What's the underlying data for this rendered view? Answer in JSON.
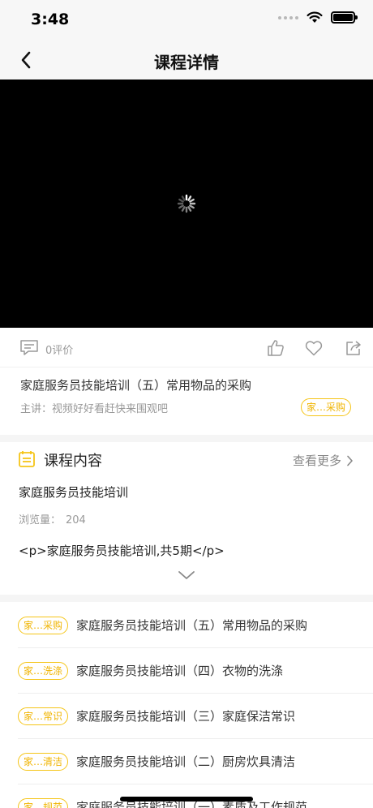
{
  "status_bar": {
    "time": "3:48"
  },
  "nav": {
    "title": "课程详情"
  },
  "video": {
    "state": "loading"
  },
  "actions": {
    "comment_count": "0评价"
  },
  "course": {
    "title": "家庭服务员技能培训（五）常用物品的采购",
    "lecturer": "主讲：视频好好看赶快来围观吧",
    "tag": "家…采购"
  },
  "content_section": {
    "title": "课程内容",
    "view_more": "查看更多",
    "name": "家庭服务员技能培训",
    "view_label": "浏览量：",
    "view_count": "204",
    "description": "<p>家庭服务员技能培训,共5期</p>"
  },
  "episodes": [
    {
      "tag": "家…采购",
      "title": "家庭服务员技能培训（五）常用物品的采购"
    },
    {
      "tag": "家…洗涤",
      "title": "家庭服务员技能培训（四）衣物的洗涤"
    },
    {
      "tag": "家…常识",
      "title": "家庭服务员技能培训（三）家庭保洁常识"
    },
    {
      "tag": "家…清洁",
      "title": "家庭服务员技能培训（二）厨房炊具清洁"
    },
    {
      "tag": "家…规范",
      "title": "家庭服务员技能培训（一）素质及工作规范"
    }
  ],
  "colors": {
    "accent": "#f5c518",
    "tag_text": "#f0b400"
  }
}
